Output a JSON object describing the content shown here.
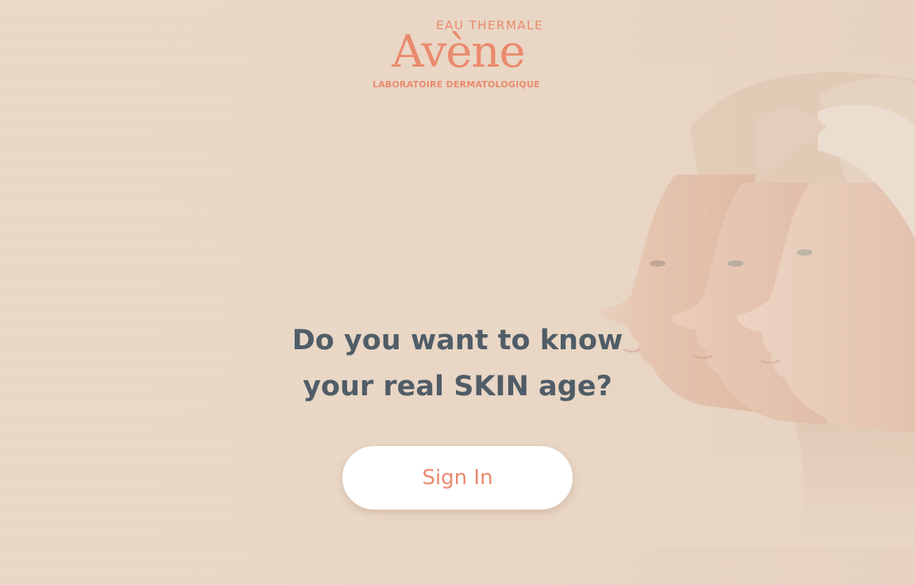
{
  "brand": {
    "top_line": "EAU THERMALE",
    "name": "Avène",
    "bottom_line": "LABORATOIRE DERMATOLOGIQUE",
    "color": "#ea8a6e"
  },
  "hero": {
    "headline_line1": "Do you want to know",
    "headline_line2": "your real SKIN age?",
    "headline_color": "#505d68",
    "image": "three-women-faces-profile-aging"
  },
  "actions": {
    "sign_in_label": "Sign In"
  },
  "background_color": "#e9d7c6"
}
